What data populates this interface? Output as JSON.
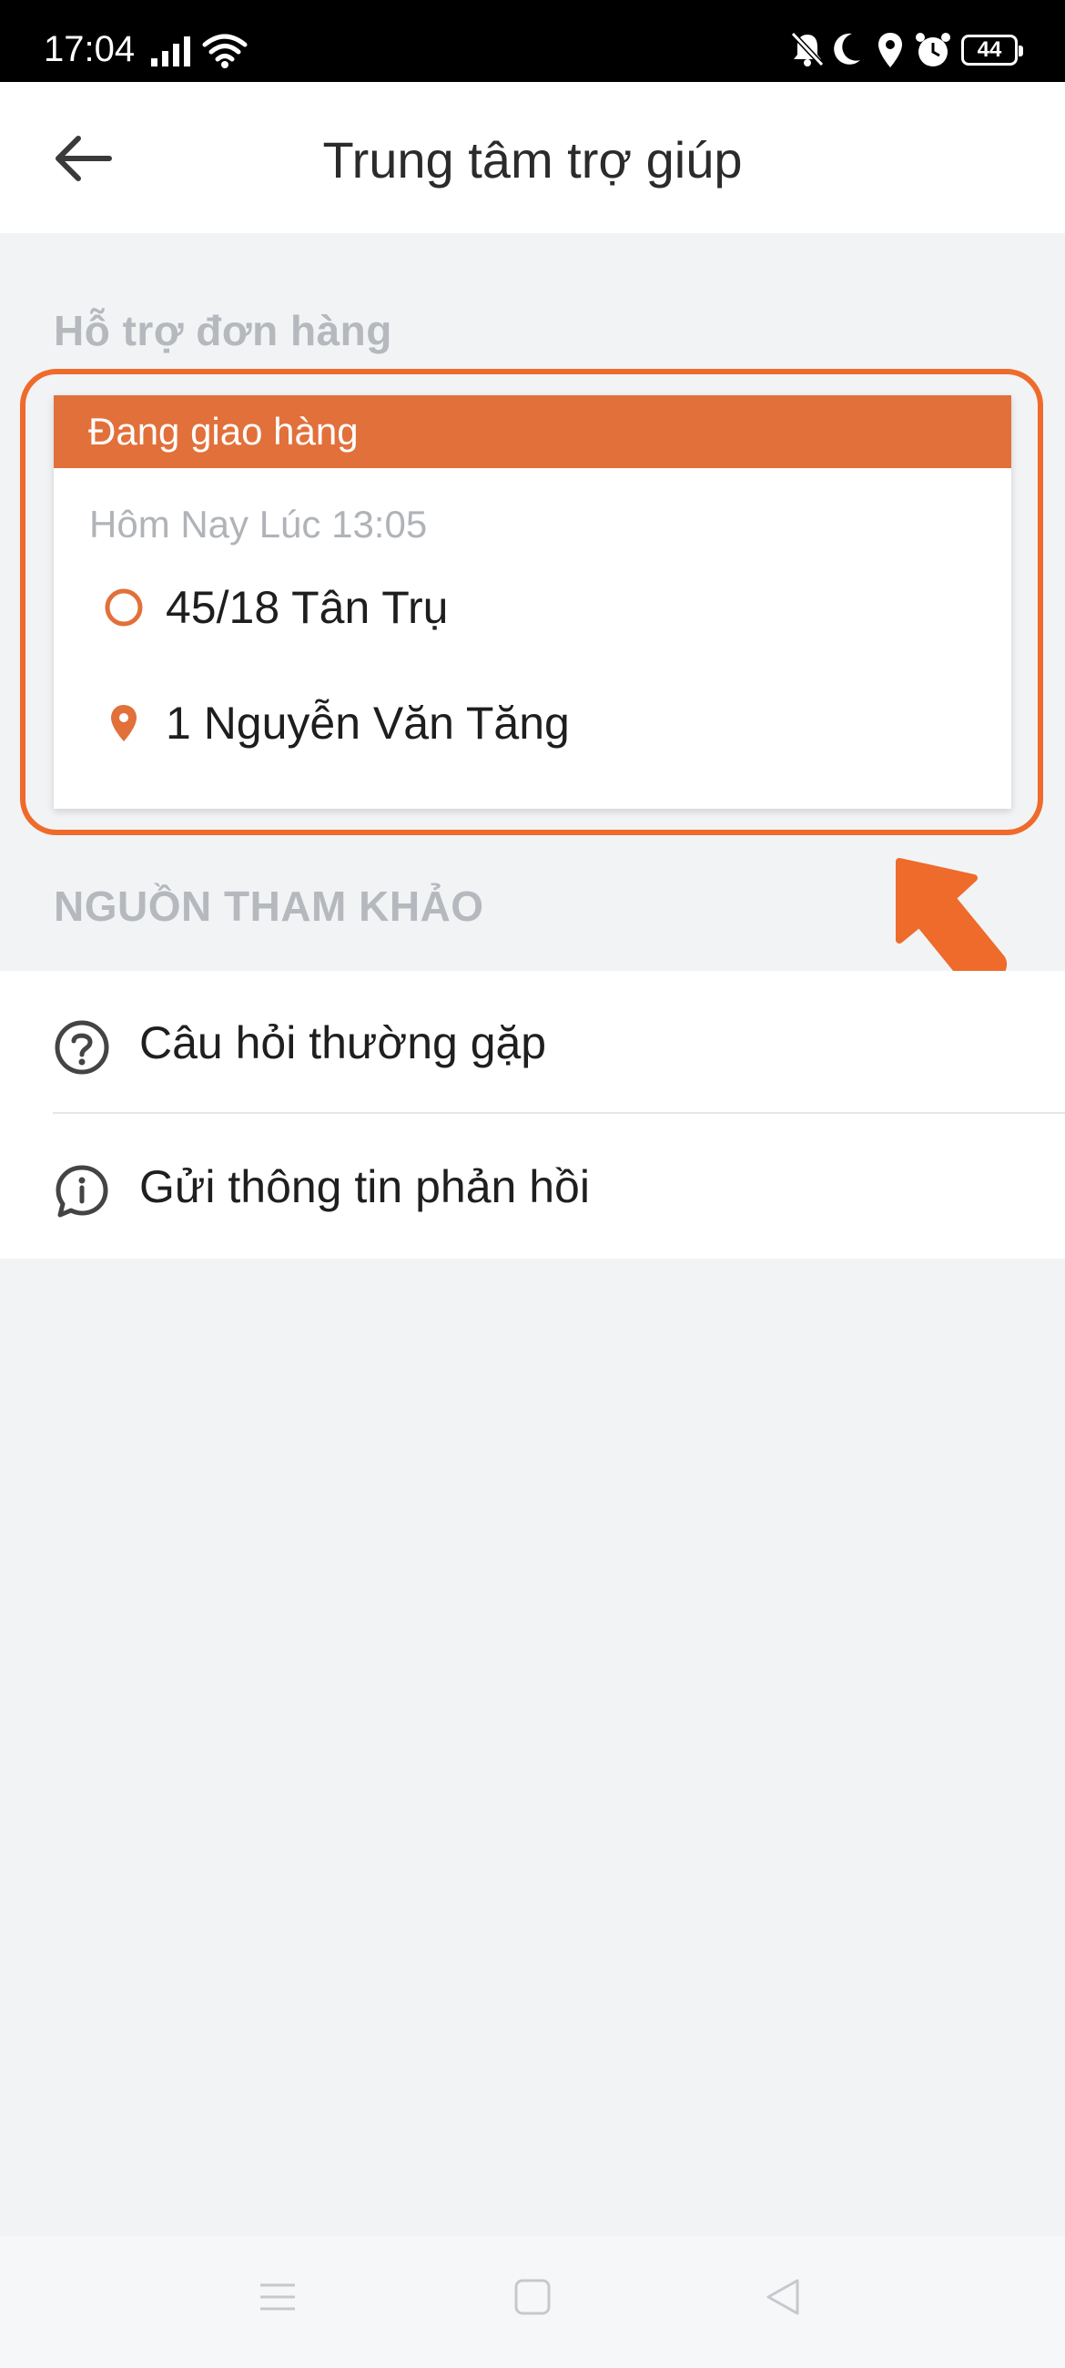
{
  "status_bar": {
    "time": "17:04",
    "battery": "44",
    "icons": [
      "signal-icon",
      "wifi-icon",
      "mute-icon",
      "moon-icon",
      "location-icon",
      "alarm-icon",
      "battery-icon"
    ]
  },
  "header": {
    "title": "Trung tâm trợ giúp",
    "back_icon": "arrow-left-icon"
  },
  "order_support": {
    "section_title": "Hỗ trợ đơn hàng",
    "card": {
      "status": "Đang giao hàng",
      "time": "Hôm Nay Lúc 13:05",
      "pickup": "45/18 Tân Trụ",
      "dropoff": "1 Nguyễn Văn Tăng"
    }
  },
  "references": {
    "section_title": "NGUỒN THAM KHẢO",
    "items": [
      {
        "label": "Câu hỏi thường gặp",
        "icon": "question-circle-icon"
      },
      {
        "label": "Gửi thông tin phản hồi",
        "icon": "info-bubble-icon"
      }
    ]
  },
  "colors": {
    "accent": "#e2703a",
    "highlight": "#ee6b2b"
  }
}
